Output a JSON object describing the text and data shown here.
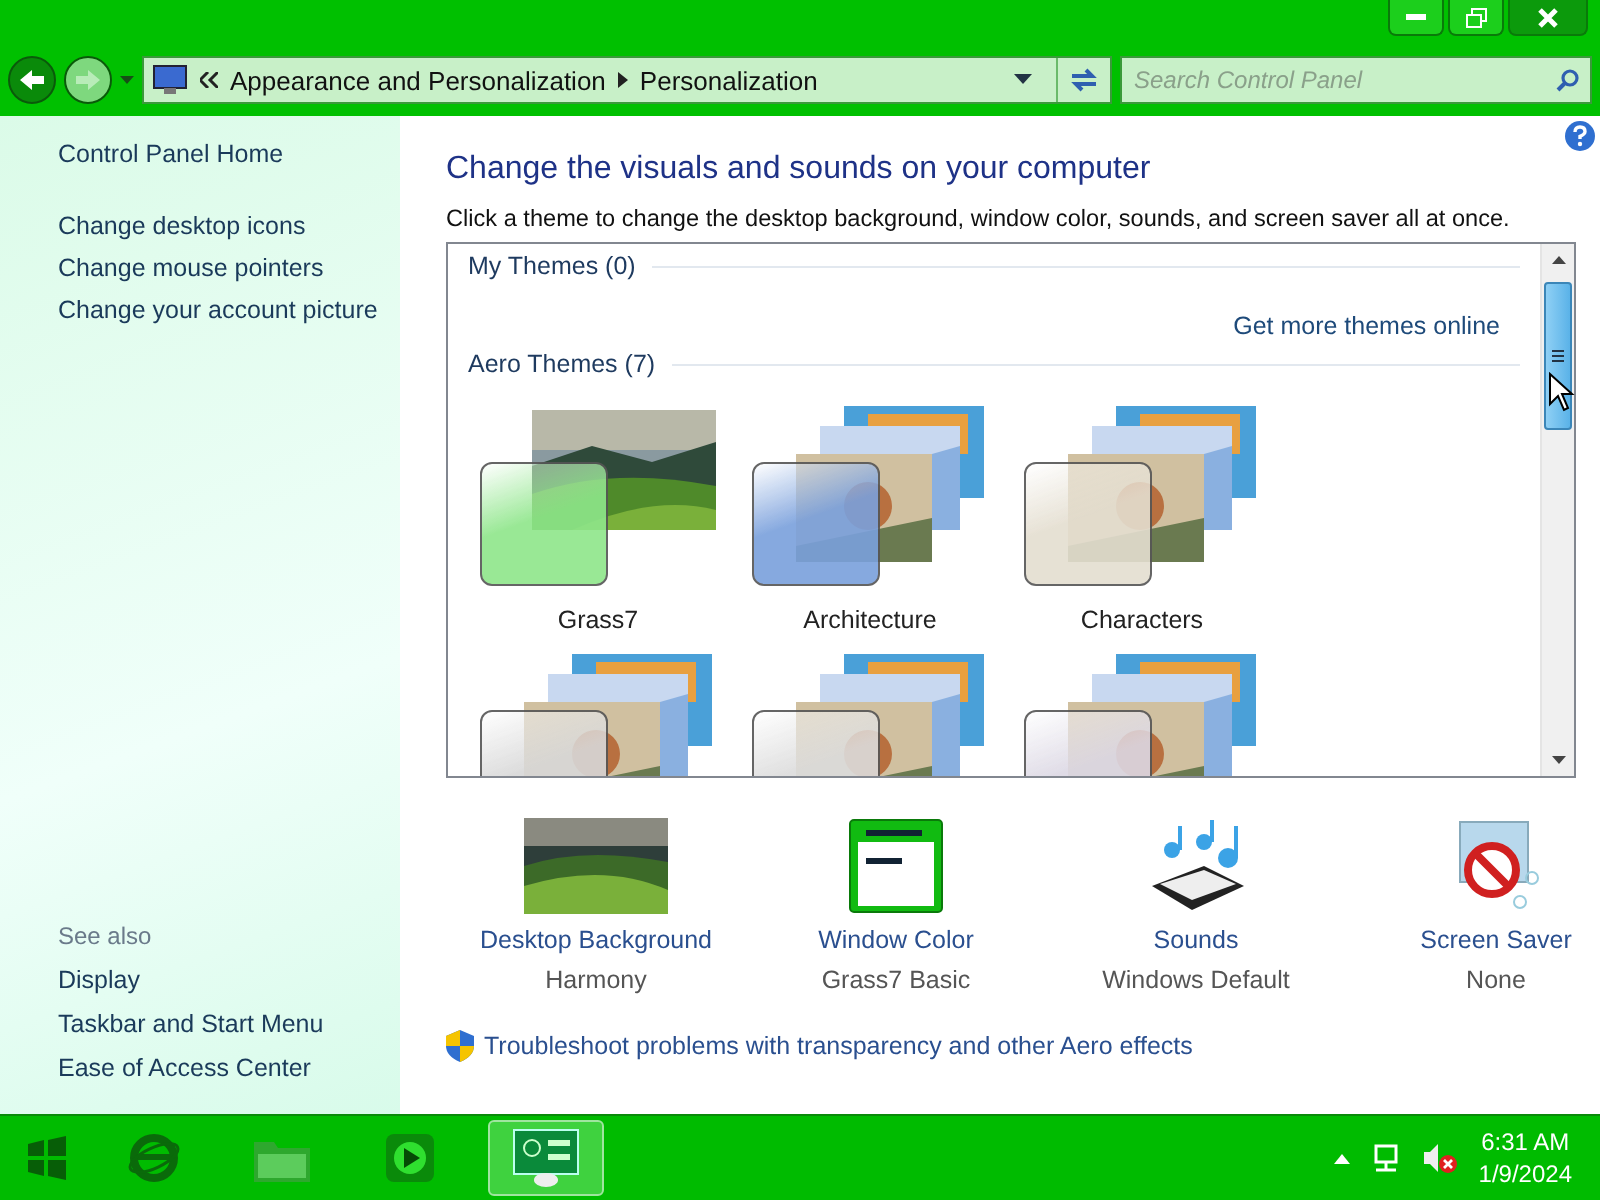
{
  "address_bar": {
    "breadcrumbs": [
      "Appearance and Personalization",
      "Personalization"
    ]
  },
  "search": {
    "placeholder": "Search Control Panel"
  },
  "sidebar": {
    "home": "Control Panel Home",
    "links": [
      "Change desktop icons",
      "Change mouse pointers",
      "Change your account picture"
    ],
    "see_also": {
      "title": "See also",
      "links": [
        "Display",
        "Taskbar and Start Menu",
        "Ease of Access Center"
      ]
    }
  },
  "main": {
    "heading": "Change the visuals and sounds on your computer",
    "description": "Click a theme to change the desktop background, window color, sounds, and screen saver all at once.",
    "my_themes": "My Themes (0)",
    "more_link": "Get more themes online",
    "aero_themes": "Aero Themes (7)",
    "themes": [
      {
        "name": "Grass7",
        "color": "#8ee68a",
        "kind": "landscape"
      },
      {
        "name": "Architecture",
        "color": "#7aa0dc",
        "kind": "stack"
      },
      {
        "name": "Characters",
        "color": "#e4ded0",
        "kind": "stack"
      },
      {
        "color": "#d8d8d8",
        "kind": "stack"
      },
      {
        "color": "#dcdcdc",
        "kind": "stack"
      },
      {
        "color": "#dcd8e4",
        "kind": "stack"
      }
    ]
  },
  "settings": [
    {
      "kind": "background",
      "label": "Desktop Background",
      "value": "Harmony"
    },
    {
      "kind": "window-color",
      "label": "Window Color",
      "value": "Grass7 Basic"
    },
    {
      "kind": "sounds",
      "label": "Sounds",
      "value": "Windows Default"
    },
    {
      "kind": "screen-saver",
      "label": "Screen Saver",
      "value": "None"
    }
  ],
  "troubleshoot": "Troubleshoot problems with transparency and other Aero effects",
  "taskbar": {
    "apps": [
      {
        "kind": "browser",
        "selected": false
      },
      {
        "kind": "folder",
        "selected": false
      },
      {
        "kind": "player",
        "selected": false
      },
      {
        "kind": "control-panel",
        "selected": true
      }
    ],
    "time": "6:31 AM",
    "date": "1/9/2024"
  }
}
